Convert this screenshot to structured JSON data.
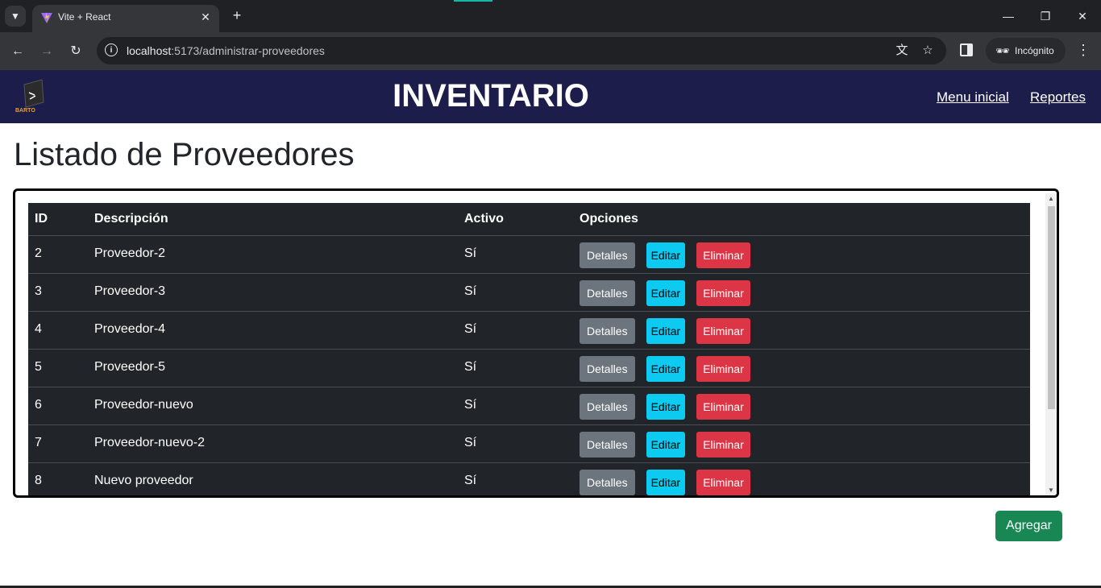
{
  "browser": {
    "tab_title": "Vite + React",
    "url_host": "localhost",
    "url_rest": ":5173/administrar-proveedores",
    "incognito_label": "Incógnito",
    "icons": [
      "chevron-down-icon",
      "vite-favicon",
      "close-icon",
      "plus-icon",
      "minimize-icon",
      "restore-icon",
      "close-window-icon",
      "back-icon",
      "forward-icon",
      "reload-icon",
      "info-icon",
      "translate-icon",
      "star-icon",
      "side-panel-icon",
      "incognito-icon",
      "menu-dots-icon"
    ]
  },
  "header": {
    "logo_text": "BARTO",
    "title": "INVENTARIO",
    "nav": [
      {
        "label": "Menu inicial"
      },
      {
        "label": "Reportes"
      }
    ],
    "background": "#1c1d4a"
  },
  "page": {
    "title": "Listado de Proveedores"
  },
  "table": {
    "columns": [
      "ID",
      "Descripción",
      "Activo",
      "Opciones"
    ],
    "buttons": {
      "details": "Detalles",
      "edit": "Editar",
      "delete": "Eliminar"
    },
    "rows": [
      {
        "id": "2",
        "descripcion": "Proveedor-2",
        "activo": "Sí"
      },
      {
        "id": "3",
        "descripcion": "Proveedor-3",
        "activo": "Sí"
      },
      {
        "id": "4",
        "descripcion": "Proveedor-4",
        "activo": "Sí"
      },
      {
        "id": "5",
        "descripcion": "Proveedor-5",
        "activo": "Sí"
      },
      {
        "id": "6",
        "descripcion": "Proveedor-nuevo",
        "activo": "Sí"
      },
      {
        "id": "7",
        "descripcion": "Proveedor-nuevo-2",
        "activo": "Sí"
      },
      {
        "id": "8",
        "descripcion": "Nuevo proveedor",
        "activo": "Sí"
      }
    ]
  },
  "actions": {
    "add_label": "Agregar"
  },
  "colors": {
    "details": "#6c757d",
    "edit": "#0dcaf0",
    "delete": "#dc3545",
    "add": "#198754",
    "table_bg": "#212529"
  }
}
